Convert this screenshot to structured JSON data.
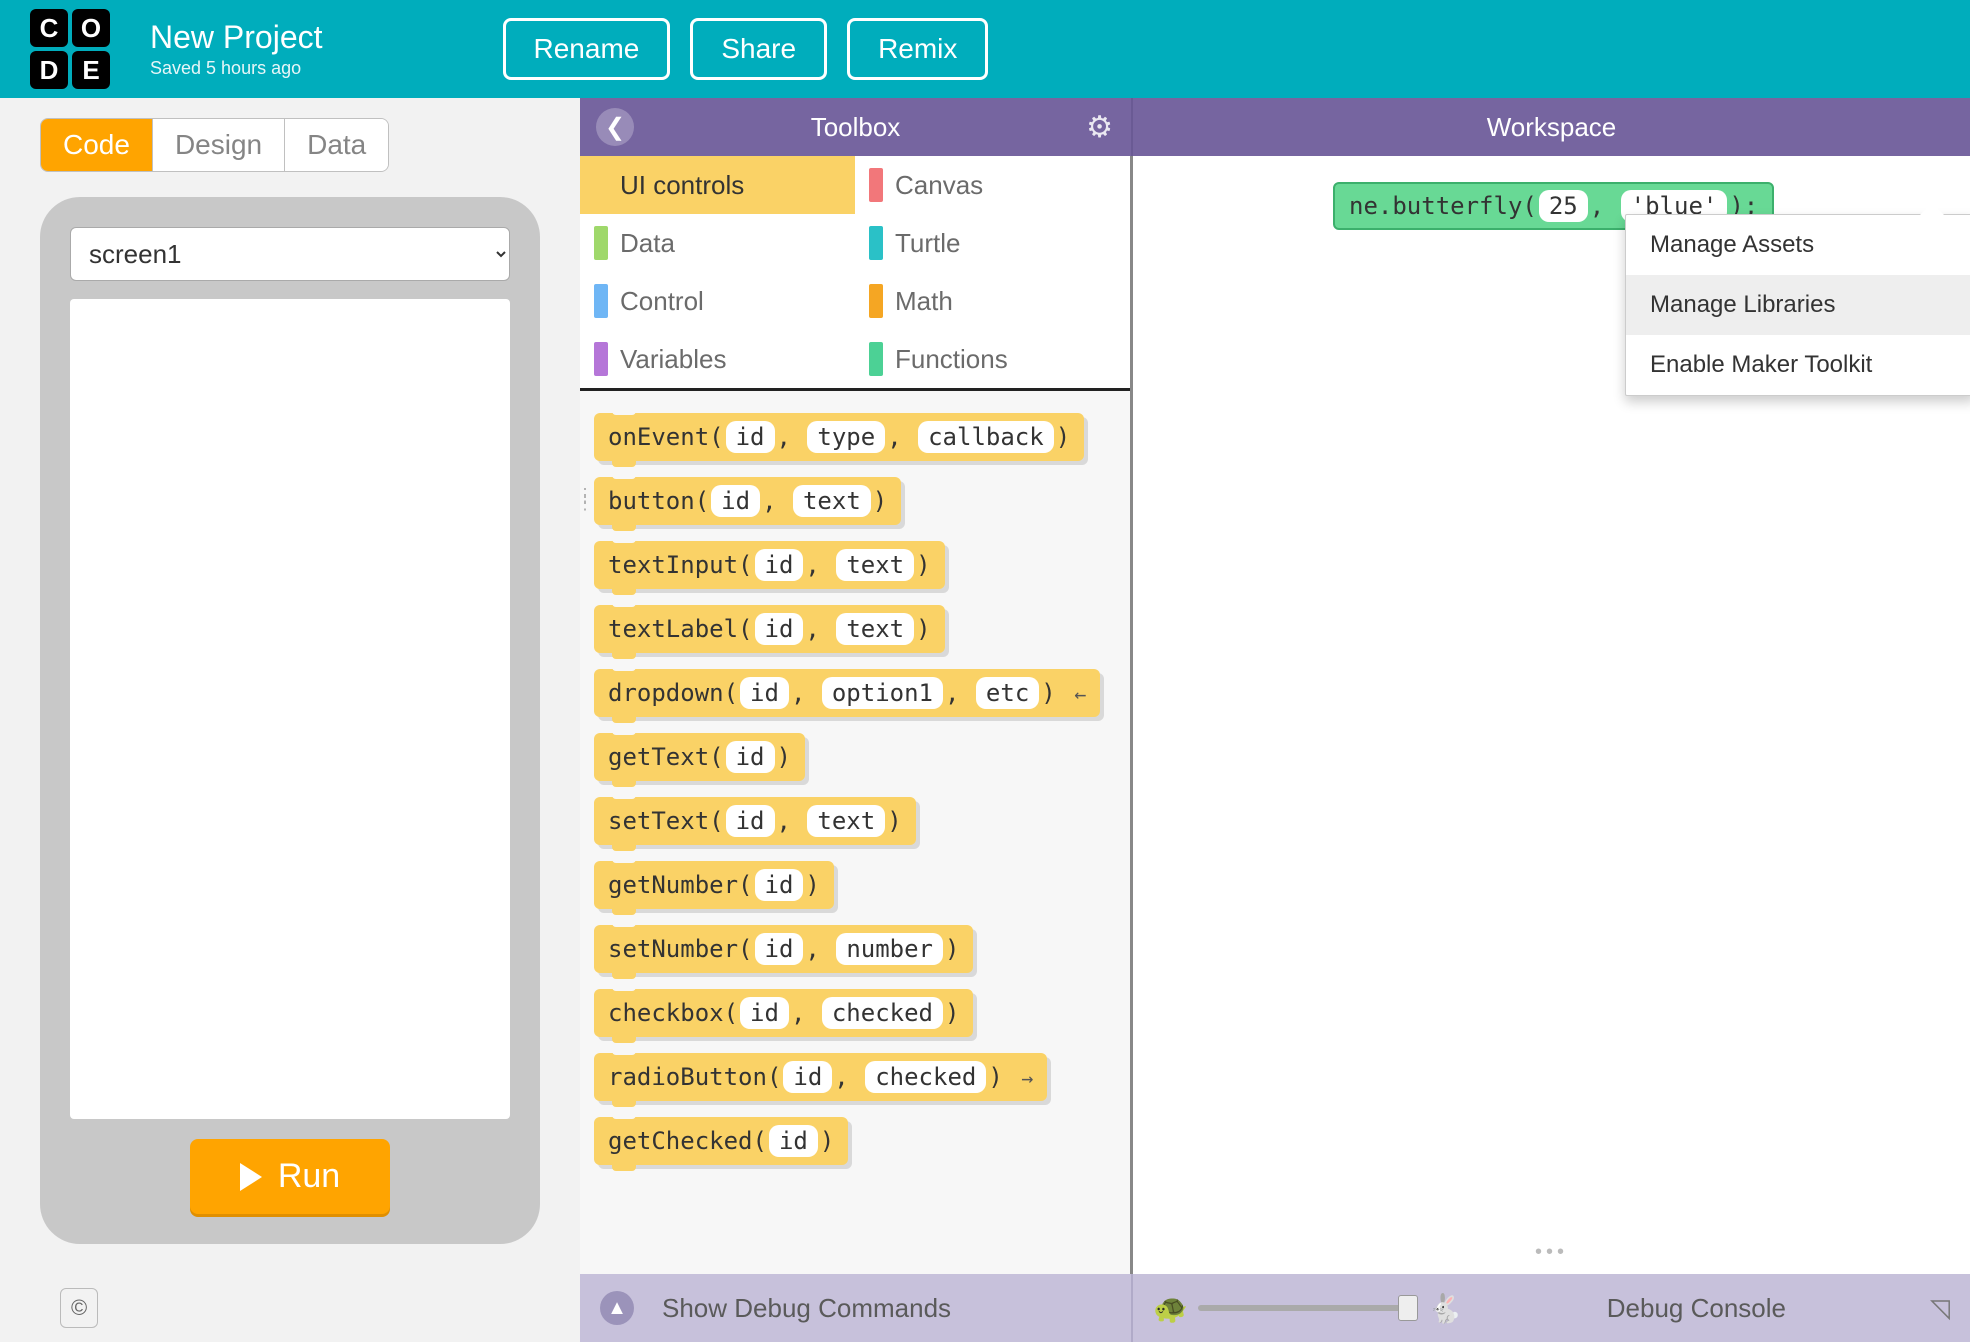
{
  "header": {
    "logo": [
      "C",
      "O",
      "D",
      "E"
    ],
    "project_title": "New Project",
    "saved_text": "Saved 5 hours ago",
    "rename": "Rename",
    "share": "Share",
    "remix": "Remix"
  },
  "tabs": {
    "code": "Code",
    "design": "Design",
    "data": "Data"
  },
  "phone": {
    "screen_select": "screen1",
    "run": "Run"
  },
  "panel": {
    "toolbox": "Toolbox",
    "workspace": "Workspace"
  },
  "dropdown": {
    "manage_assets": "Manage Assets",
    "manage_libraries": "Manage Libraries",
    "enable_maker": "Enable Maker Toolkit"
  },
  "categories": {
    "ui": "UI controls",
    "data": "Data",
    "control": "Control",
    "variables": "Variables",
    "canvas": "Canvas",
    "turtle": "Turtle",
    "math": "Math",
    "functions": "Functions"
  },
  "colors": {
    "ui": "#fad266",
    "data": "#9fd86b",
    "control": "#6fb6f5",
    "variables": "#b576d8",
    "canvas": "#f2777a",
    "turtle": "#2ac1c7",
    "math": "#f5a623",
    "functions": "#4cd195"
  },
  "blocks": [
    {
      "fn": "onEvent",
      "args": [
        "id",
        "type",
        "callback"
      ]
    },
    {
      "fn": "button",
      "args": [
        "id",
        "text"
      ]
    },
    {
      "fn": "textInput",
      "args": [
        "id",
        "text"
      ]
    },
    {
      "fn": "textLabel",
      "args": [
        "id",
        "text"
      ]
    },
    {
      "fn": "dropdown",
      "args": [
        "id",
        "option1",
        "etc"
      ],
      "arrow": "←"
    },
    {
      "fn": "getText",
      "args": [
        "id"
      ]
    },
    {
      "fn": "setText",
      "args": [
        "id",
        "text"
      ]
    },
    {
      "fn": "getNumber",
      "args": [
        "id"
      ]
    },
    {
      "fn": "setNumber",
      "args": [
        "id",
        "number"
      ]
    },
    {
      "fn": "checkbox",
      "args": [
        "id",
        "checked"
      ]
    },
    {
      "fn": "radioButton",
      "args": [
        "id",
        "checked"
      ],
      "arrow": "→"
    },
    {
      "fn": "getChecked",
      "args": [
        "id"
      ]
    }
  ],
  "workspace_block": {
    "prefix": "ne.butterfly(",
    "arg1": "25",
    "sep": ", ",
    "arg2": "'blue'",
    "suffix": ");"
  },
  "footer": {
    "copyright": "©",
    "show_debug": "Show Debug Commands",
    "debug_console": "Debug Console"
  }
}
